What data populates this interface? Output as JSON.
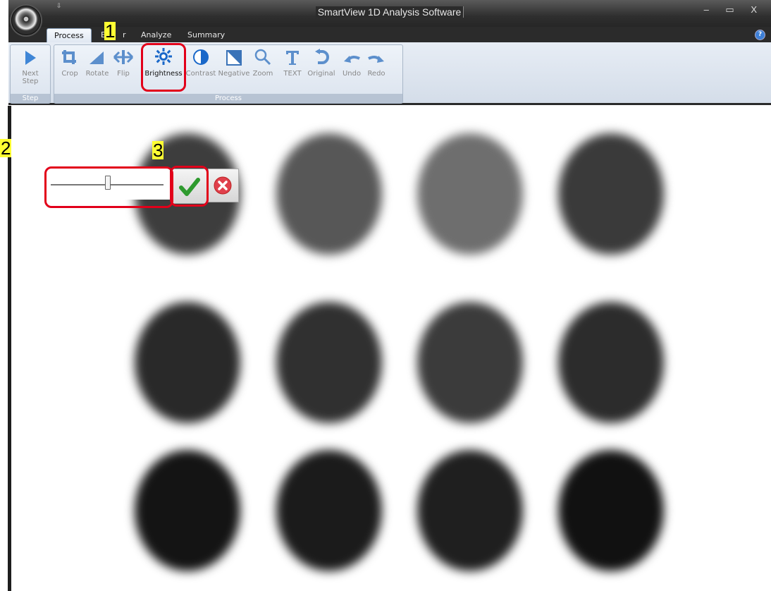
{
  "window": {
    "title": "SmartView 1D Analysis Software",
    "qat_glyph": "⇩",
    "controls": "– ▭ X",
    "help_glyph": "?"
  },
  "tabs": [
    {
      "label": "Process",
      "active": true
    },
    {
      "label": "E"
    },
    {
      "label": "r"
    },
    {
      "label": "Analyze"
    },
    {
      "label": "Summary"
    }
  ],
  "ribbon": {
    "step_group": {
      "label": "Step",
      "next_step": "Next\nStep"
    },
    "process_group": {
      "label": "Process",
      "buttons": [
        {
          "label": "Crop",
          "icon": "crop-icon"
        },
        {
          "label": "Rotate",
          "icon": "rotate-icon"
        },
        {
          "label": "Flip",
          "icon": "flip-icon"
        },
        {
          "label": "Brightness",
          "icon": "brightness-icon",
          "active": true
        },
        {
          "label": "Contrast",
          "icon": "contrast-icon"
        },
        {
          "label": "Negative",
          "icon": "negative-icon"
        },
        {
          "label": "Zoom",
          "icon": "zoom-icon"
        },
        {
          "label": "TEXT",
          "icon": "text-icon"
        },
        {
          "label": "Original",
          "icon": "original-icon"
        },
        {
          "label": "Undo",
          "icon": "undo-icon"
        },
        {
          "label": "Redo",
          "icon": "redo-icon"
        }
      ]
    }
  },
  "annotations": {
    "n1": "1",
    "n2": "2",
    "n3": "3"
  },
  "brightness_slider": {
    "value_fraction": 0.5
  },
  "colors": {
    "accent_icon": "#1a68c9",
    "highlight": "#e2001a",
    "callout_bg": "#ffff33"
  }
}
